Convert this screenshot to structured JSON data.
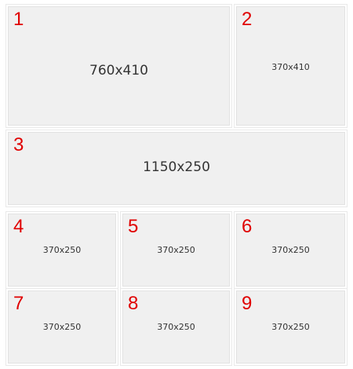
{
  "tiles": [
    {
      "number": "1",
      "label": "760x410"
    },
    {
      "number": "2",
      "label": "370x410"
    },
    {
      "number": "3",
      "label": "1150x250"
    },
    {
      "number": "4",
      "label": "370x250"
    },
    {
      "number": "5",
      "label": "370x250"
    },
    {
      "number": "6",
      "label": "370x250"
    },
    {
      "number": "7",
      "label": "370x250"
    },
    {
      "number": "8",
      "label": "370x250"
    },
    {
      "number": "9",
      "label": "370x250"
    }
  ],
  "colors": {
    "number": "#e00000",
    "tile_background": "#f0f0f0",
    "label_text": "#333333"
  }
}
